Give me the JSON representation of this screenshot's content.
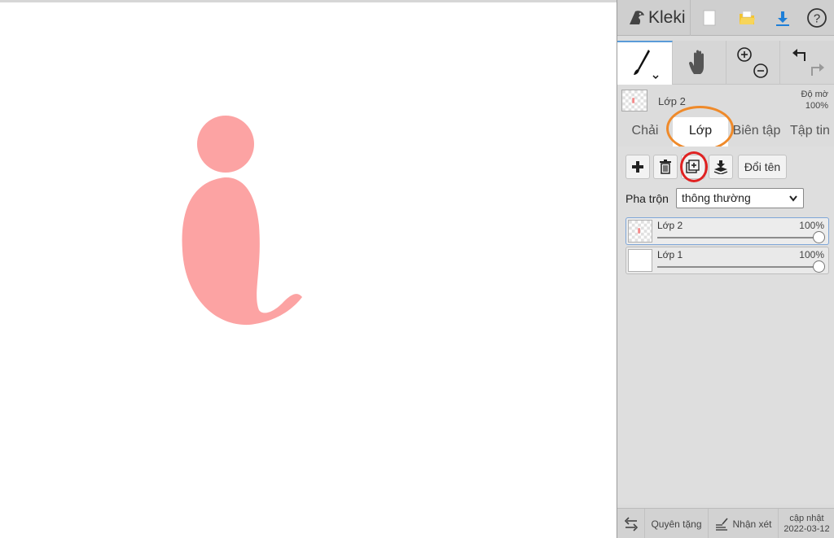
{
  "app": {
    "name": "Kleki",
    "accent": "#4a90d9"
  },
  "canvas": {
    "drawing_color": "#fca3a3"
  },
  "topbar": {
    "icons": [
      "kleki-logo-icon",
      "new-image-icon",
      "open-folder-icon",
      "download-icon",
      "help-icon"
    ],
    "help_glyph": "?"
  },
  "tools": {
    "icons": [
      "brush-icon",
      "hand-icon",
      "zoom-in-icon",
      "zoom-out-icon",
      "undo-icon",
      "redo-icon"
    ]
  },
  "layer_info": {
    "name": "Lớp 2",
    "opacity_label": "Độ mờ",
    "opacity_value": "100%"
  },
  "tabs": [
    {
      "label": "Chải",
      "active": false
    },
    {
      "label": "Lớp",
      "active": true
    },
    {
      "label": "Biên tập",
      "active": false
    },
    {
      "label": "Tập tin",
      "active": false
    }
  ],
  "layers_panel": {
    "buttons": [
      "add-layer-icon",
      "delete-layer-icon",
      "duplicate-layer-icon",
      "merge-layer-icon"
    ],
    "rename_label": "Đổi tên",
    "blend_label": "Pha trộn",
    "blend_value": "thông thường",
    "layers": [
      {
        "name": "Lớp 2",
        "opacity": "100%",
        "selected": true
      },
      {
        "name": "Lớp 1",
        "opacity": "100%",
        "selected": false
      }
    ]
  },
  "bottom": {
    "donate": "Quyên tặng",
    "feedback": "Nhận xét",
    "update_label": "cập nhật",
    "update_date": "2022-03-12"
  },
  "highlights": {
    "orange": "#ef8a2a",
    "red": "#e02222"
  }
}
